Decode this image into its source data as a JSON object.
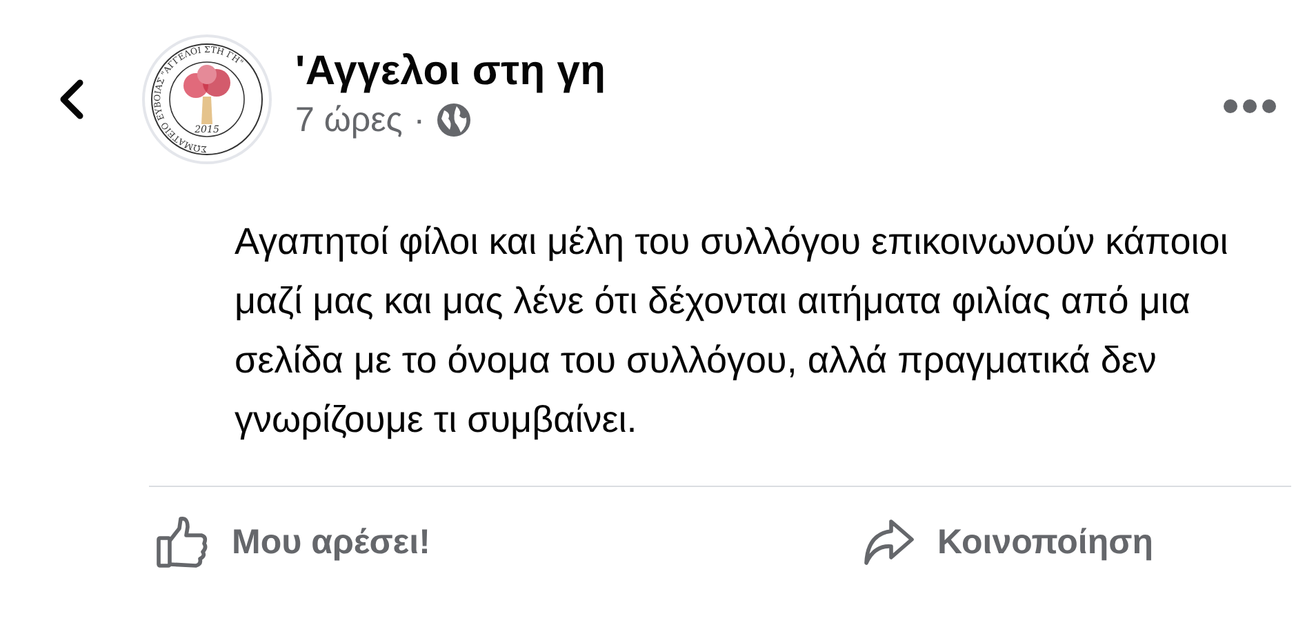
{
  "post": {
    "page_name": "'Αγγελοι στη γη",
    "time": "7 ώρες",
    "separator": "·",
    "logo": {
      "ring_text": "ΣΩΜΑΤΕΙΟ ΕΥΒΟΙΑΣ \"ΑΓΓΕΛΟΙ ΣΤΗ ΓΗ\"",
      "year": "2015"
    },
    "body": "Αγαπητοί φίλοι και μέλη του συλλόγου επικοινωνούν κάποιοι μαζί μας και μας λένε ότι δέχονται αιτήματα φιλίας από μια σελίδα με το όνομα του συλλόγου, αλλά πραγματικά δεν γνωρίζουμε τι συμβαίνει."
  },
  "actions": [
    {
      "kind": "like",
      "label": "Μου αρέσει!"
    },
    {
      "kind": "share",
      "label": "Κοινοποίηση"
    }
  ]
}
